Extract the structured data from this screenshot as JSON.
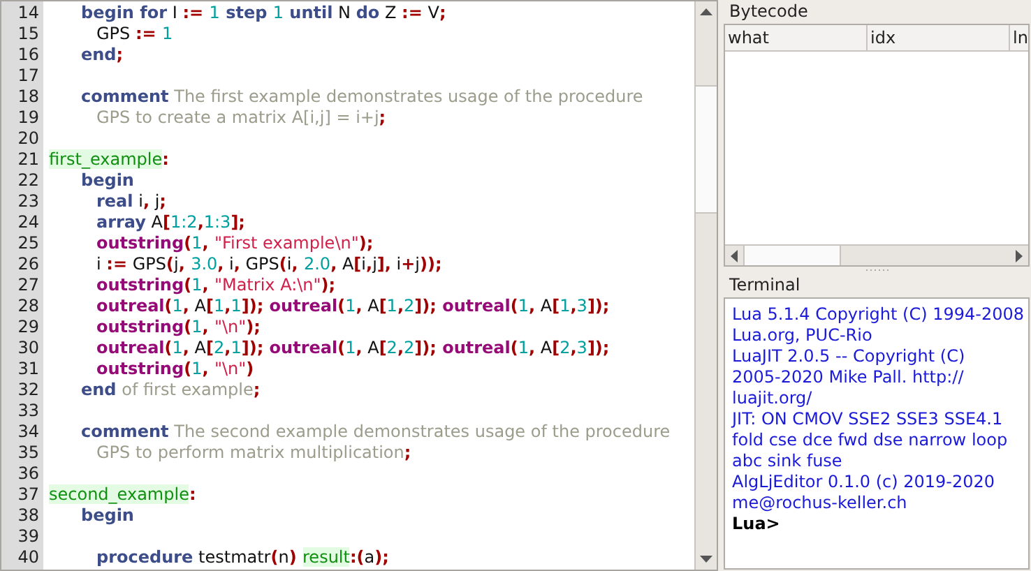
{
  "editor": {
    "lines": [
      {
        "number": "14",
        "kind": "block",
        "tokens": [
          {
            "kind": "kw",
            "text": "begin for"
          },
          {
            "kind": "plain",
            "text": " I "
          },
          {
            "kind": "op",
            "text": ":= "
          },
          {
            "kind": "num",
            "text": "1"
          },
          {
            "kind": "kw",
            "text": " step "
          },
          {
            "kind": "num",
            "text": "1"
          },
          {
            "kind": "kw",
            "text": " until"
          },
          {
            "kind": "plain",
            "text": " N "
          },
          {
            "kind": "kw",
            "text": "do"
          },
          {
            "kind": "plain",
            "text": " Z "
          },
          {
            "kind": "op",
            "text": ":="
          },
          {
            "kind": "plain",
            "text": " V"
          },
          {
            "kind": "op",
            "text": ";"
          }
        ]
      },
      {
        "number": "15",
        "kind": "inner",
        "tokens": [
          {
            "kind": "plain",
            "text": "GPS "
          },
          {
            "kind": "op",
            "text": ":= "
          },
          {
            "kind": "num",
            "text": "1"
          }
        ]
      },
      {
        "number": "16",
        "kind": "block",
        "tokens": [
          {
            "kind": "kw",
            "text": "end"
          },
          {
            "kind": "op",
            "text": ";"
          }
        ]
      },
      {
        "number": "17",
        "kind": "blank"
      },
      {
        "number": "18",
        "kind": "block",
        "tokens": [
          {
            "kind": "kw",
            "text": "comment"
          },
          {
            "kind": "comment",
            "text": " The first example demonstrates usage of the procedure"
          }
        ]
      },
      {
        "number": "19",
        "kind": "inner",
        "tokens": [
          {
            "kind": "comment",
            "text": "GPS to create a matrix A[i,j] = i+j"
          },
          {
            "kind": "op",
            "text": ";"
          }
        ]
      },
      {
        "number": "20",
        "kind": "blank"
      },
      {
        "number": "21",
        "kind": "label",
        "tokens": [
          {
            "kind": "label",
            "text": "first_example"
          },
          {
            "kind": "op",
            "text": ":"
          }
        ]
      },
      {
        "number": "22",
        "kind": "block",
        "tokens": [
          {
            "kind": "kw",
            "text": "begin"
          }
        ]
      },
      {
        "number": "23",
        "kind": "inner",
        "tokens": [
          {
            "kind": "kw",
            "text": "real"
          },
          {
            "kind": "plain",
            "text": " i"
          },
          {
            "kind": "op",
            "text": ","
          },
          {
            "kind": "plain",
            "text": " j"
          },
          {
            "kind": "op",
            "text": ";"
          }
        ]
      },
      {
        "number": "24",
        "kind": "inner",
        "tokens": [
          {
            "kind": "kw",
            "text": "array"
          },
          {
            "kind": "plain",
            "text": " A"
          },
          {
            "kind": "op",
            "text": "["
          },
          {
            "kind": "num",
            "text": "1:2"
          },
          {
            "kind": "op",
            "text": ","
          },
          {
            "kind": "num",
            "text": "1:3"
          },
          {
            "kind": "op",
            "text": "];"
          }
        ]
      },
      {
        "number": "25",
        "kind": "inner",
        "tokens": [
          {
            "kind": "call",
            "text": "outstring"
          },
          {
            "kind": "op",
            "text": "("
          },
          {
            "kind": "num",
            "text": "1"
          },
          {
            "kind": "op",
            "text": ", "
          },
          {
            "kind": "str",
            "text": "\"First example\\n\""
          },
          {
            "kind": "op",
            "text": ");"
          }
        ]
      },
      {
        "number": "26",
        "kind": "inner",
        "tokens": [
          {
            "kind": "plain",
            "text": "i "
          },
          {
            "kind": "op",
            "text": ":="
          },
          {
            "kind": "plain",
            "text": " GPS"
          },
          {
            "kind": "op",
            "text": "("
          },
          {
            "kind": "plain",
            "text": "j"
          },
          {
            "kind": "op",
            "text": ", "
          },
          {
            "kind": "num",
            "text": "3.0"
          },
          {
            "kind": "op",
            "text": ","
          },
          {
            "kind": "plain",
            "text": " i"
          },
          {
            "kind": "op",
            "text": ","
          },
          {
            "kind": "plain",
            "text": " GPS"
          },
          {
            "kind": "op",
            "text": "("
          },
          {
            "kind": "plain",
            "text": "i"
          },
          {
            "kind": "op",
            "text": ", "
          },
          {
            "kind": "num",
            "text": "2.0"
          },
          {
            "kind": "op",
            "text": ","
          },
          {
            "kind": "plain",
            "text": " A"
          },
          {
            "kind": "op",
            "text": "["
          },
          {
            "kind": "plain",
            "text": "i"
          },
          {
            "kind": "op",
            "text": ","
          },
          {
            "kind": "plain",
            "text": "j"
          },
          {
            "kind": "op",
            "text": "],"
          },
          {
            "kind": "plain",
            "text": " i"
          },
          {
            "kind": "op",
            "text": "+"
          },
          {
            "kind": "plain",
            "text": "j"
          },
          {
            "kind": "op",
            "text": "));"
          }
        ]
      },
      {
        "number": "27",
        "kind": "inner",
        "tokens": [
          {
            "kind": "call",
            "text": "outstring"
          },
          {
            "kind": "op",
            "text": "("
          },
          {
            "kind": "num",
            "text": "1"
          },
          {
            "kind": "op",
            "text": ", "
          },
          {
            "kind": "str",
            "text": "\"Matrix A:\\n\""
          },
          {
            "kind": "op",
            "text": ");"
          }
        ]
      },
      {
        "number": "28",
        "kind": "inner",
        "tokens": [
          {
            "kind": "call",
            "text": "outreal"
          },
          {
            "kind": "op",
            "text": "("
          },
          {
            "kind": "num",
            "text": "1"
          },
          {
            "kind": "op",
            "text": ","
          },
          {
            "kind": "plain",
            "text": " A"
          },
          {
            "kind": "op",
            "text": "["
          },
          {
            "kind": "num",
            "text": "1"
          },
          {
            "kind": "op",
            "text": ","
          },
          {
            "kind": "num",
            "text": "1"
          },
          {
            "kind": "op",
            "text": "]); "
          },
          {
            "kind": "call",
            "text": "outreal"
          },
          {
            "kind": "op",
            "text": "("
          },
          {
            "kind": "num",
            "text": "1"
          },
          {
            "kind": "op",
            "text": ","
          },
          {
            "kind": "plain",
            "text": " A"
          },
          {
            "kind": "op",
            "text": "["
          },
          {
            "kind": "num",
            "text": "1"
          },
          {
            "kind": "op",
            "text": ","
          },
          {
            "kind": "num",
            "text": "2"
          },
          {
            "kind": "op",
            "text": "]); "
          },
          {
            "kind": "call",
            "text": "outreal"
          },
          {
            "kind": "op",
            "text": "("
          },
          {
            "kind": "num",
            "text": "1"
          },
          {
            "kind": "op",
            "text": ","
          },
          {
            "kind": "plain",
            "text": " A"
          },
          {
            "kind": "op",
            "text": "["
          },
          {
            "kind": "num",
            "text": "1"
          },
          {
            "kind": "op",
            "text": ","
          },
          {
            "kind": "num",
            "text": "3"
          },
          {
            "kind": "op",
            "text": "]);"
          }
        ]
      },
      {
        "number": "29",
        "kind": "inner",
        "tokens": [
          {
            "kind": "call",
            "text": "outstring"
          },
          {
            "kind": "op",
            "text": "("
          },
          {
            "kind": "num",
            "text": "1"
          },
          {
            "kind": "op",
            "text": ", "
          },
          {
            "kind": "str",
            "text": "\"\\n\""
          },
          {
            "kind": "op",
            "text": ");"
          }
        ]
      },
      {
        "number": "30",
        "kind": "inner",
        "tokens": [
          {
            "kind": "call",
            "text": "outreal"
          },
          {
            "kind": "op",
            "text": "("
          },
          {
            "kind": "num",
            "text": "1"
          },
          {
            "kind": "op",
            "text": ","
          },
          {
            "kind": "plain",
            "text": " A"
          },
          {
            "kind": "op",
            "text": "["
          },
          {
            "kind": "num",
            "text": "2"
          },
          {
            "kind": "op",
            "text": ","
          },
          {
            "kind": "num",
            "text": "1"
          },
          {
            "kind": "op",
            "text": "]); "
          },
          {
            "kind": "call",
            "text": "outreal"
          },
          {
            "kind": "op",
            "text": "("
          },
          {
            "kind": "num",
            "text": "1"
          },
          {
            "kind": "op",
            "text": ","
          },
          {
            "kind": "plain",
            "text": " A"
          },
          {
            "kind": "op",
            "text": "["
          },
          {
            "kind": "num",
            "text": "2"
          },
          {
            "kind": "op",
            "text": ","
          },
          {
            "kind": "num",
            "text": "2"
          },
          {
            "kind": "op",
            "text": "]); "
          },
          {
            "kind": "call",
            "text": "outreal"
          },
          {
            "kind": "op",
            "text": "("
          },
          {
            "kind": "num",
            "text": "1"
          },
          {
            "kind": "op",
            "text": ","
          },
          {
            "kind": "plain",
            "text": " A"
          },
          {
            "kind": "op",
            "text": "["
          },
          {
            "kind": "num",
            "text": "2"
          },
          {
            "kind": "op",
            "text": ","
          },
          {
            "kind": "num",
            "text": "3"
          },
          {
            "kind": "op",
            "text": "]);"
          }
        ]
      },
      {
        "number": "31",
        "kind": "inner",
        "tokens": [
          {
            "kind": "call",
            "text": "outstring"
          },
          {
            "kind": "op",
            "text": "("
          },
          {
            "kind": "num",
            "text": "1"
          },
          {
            "kind": "op",
            "text": ", "
          },
          {
            "kind": "str",
            "text": "\"\\n\""
          },
          {
            "kind": "op",
            "text": ")"
          }
        ]
      },
      {
        "number": "32",
        "kind": "block",
        "tokens": [
          {
            "kind": "kw",
            "text": "end"
          },
          {
            "kind": "comment",
            "text": " of first example"
          },
          {
            "kind": "op",
            "text": ";"
          }
        ]
      },
      {
        "number": "33",
        "kind": "blank"
      },
      {
        "number": "34",
        "kind": "block",
        "tokens": [
          {
            "kind": "kw",
            "text": "comment"
          },
          {
            "kind": "comment",
            "text": " The second example demonstrates usage of the procedure"
          }
        ]
      },
      {
        "number": "35",
        "kind": "inner",
        "tokens": [
          {
            "kind": "comment",
            "text": "GPS to perform matrix multiplication"
          },
          {
            "kind": "op",
            "text": ";"
          }
        ]
      },
      {
        "number": "36",
        "kind": "blank"
      },
      {
        "number": "37",
        "kind": "label",
        "tokens": [
          {
            "kind": "label",
            "text": "second_example"
          },
          {
            "kind": "op",
            "text": ":"
          }
        ]
      },
      {
        "number": "38",
        "kind": "block",
        "tokens": [
          {
            "kind": "kw",
            "text": "begin"
          }
        ]
      },
      {
        "number": "39",
        "kind": "blank"
      },
      {
        "number": "40",
        "kind": "inner",
        "tokens": [
          {
            "kind": "kw",
            "text": "procedure"
          },
          {
            "kind": "plain",
            "text": " testmatr"
          },
          {
            "kind": "op",
            "text": "("
          },
          {
            "kind": "plain",
            "text": "n"
          },
          {
            "kind": "op",
            "text": ") "
          },
          {
            "kind": "label",
            "text": "result"
          },
          {
            "kind": "op",
            "text": ":("
          },
          {
            "kind": "plain",
            "text": "a"
          },
          {
            "kind": "op",
            "text": ");"
          }
        ]
      }
    ]
  },
  "bytecode": {
    "title": "Bytecode",
    "columns": [
      "what",
      "idx",
      "ln"
    ]
  },
  "terminal": {
    "title": "Terminal",
    "lines": [
      "Lua 5.1.4 Copyright (C) 1994-2008",
      "Lua.org, PUC-Rio",
      "LuaJIT 2.0.5 -- Copyright (C)",
      "2005-2020 Mike Pall. http://",
      "luajit.org/",
      "JIT: ON CMOV SSE2 SSE3 SSE4.1",
      "fold cse dce fwd dse narrow loop",
      "abc sink fuse",
      "AlgLjEditor 0.1.0 (c) 2019-2020",
      "me@rochus-keller.ch"
    ],
    "prompt": "Lua>"
  }
}
